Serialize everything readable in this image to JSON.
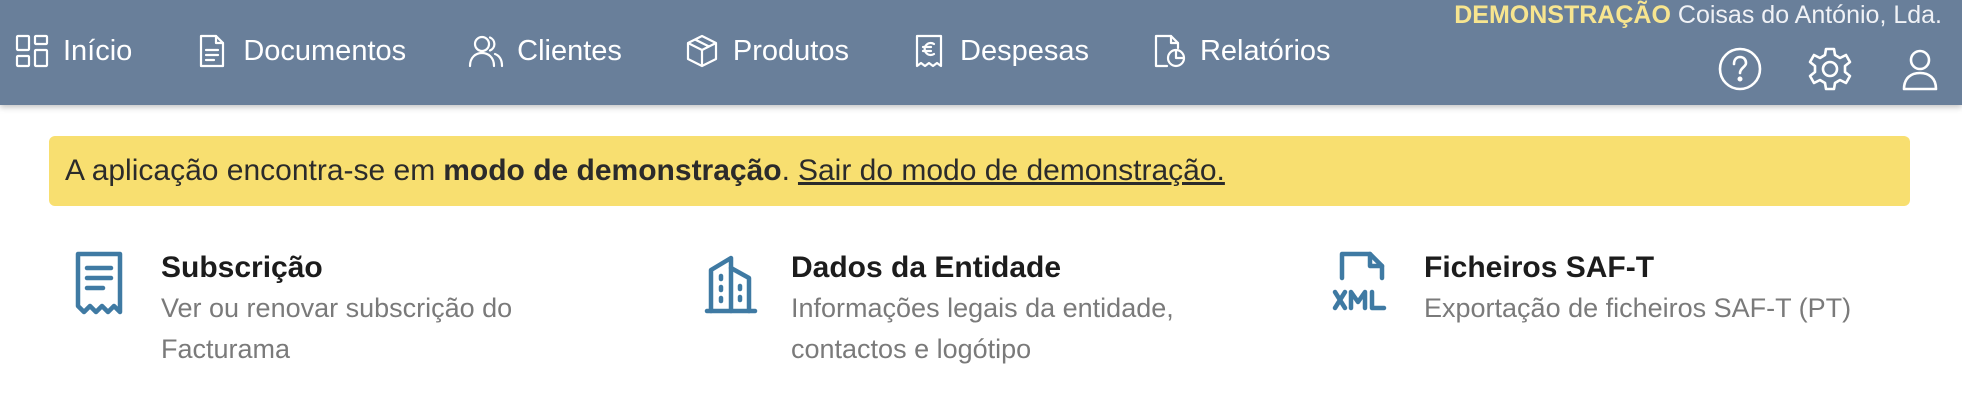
{
  "nav": {
    "items": [
      {
        "label": "Início",
        "icon": "dashboard-icon"
      },
      {
        "label": "Documentos",
        "icon": "document-icon"
      },
      {
        "label": "Clientes",
        "icon": "users-icon"
      },
      {
        "label": "Produtos",
        "icon": "box-icon"
      },
      {
        "label": "Despesas",
        "icon": "receipt-euro-icon"
      },
      {
        "label": "Relatórios",
        "icon": "report-icon"
      }
    ]
  },
  "header": {
    "demo_tag": "DEMONSTRAÇÃO",
    "company_name": "Coisas do António, Lda.",
    "icons": [
      "help-icon",
      "gear-icon",
      "user-icon"
    ]
  },
  "banner": {
    "prefix": "A aplicação encontra-se em",
    "bold": "modo de demonstração",
    "dot": ".",
    "link": "Sair do modo de demonstração."
  },
  "cards": [
    {
      "title": "Subscrição",
      "desc": "Ver ou renovar subscrição do Facturama",
      "icon": "receipt-icon"
    },
    {
      "title": "Dados da Entidade",
      "desc": "Informações legais da entidade, contactos e logótipo",
      "icon": "building-icon"
    },
    {
      "title": "Ficheiros SAF-T",
      "desc": "Exportação de ficheiros SAF-T (PT)",
      "icon": "xml-file-icon"
    }
  ],
  "colors": {
    "topbar": "#697f9a",
    "banner": "#f8df70",
    "accent_icon": "#3f7aa3",
    "demo_tag": "#f7e58f"
  }
}
